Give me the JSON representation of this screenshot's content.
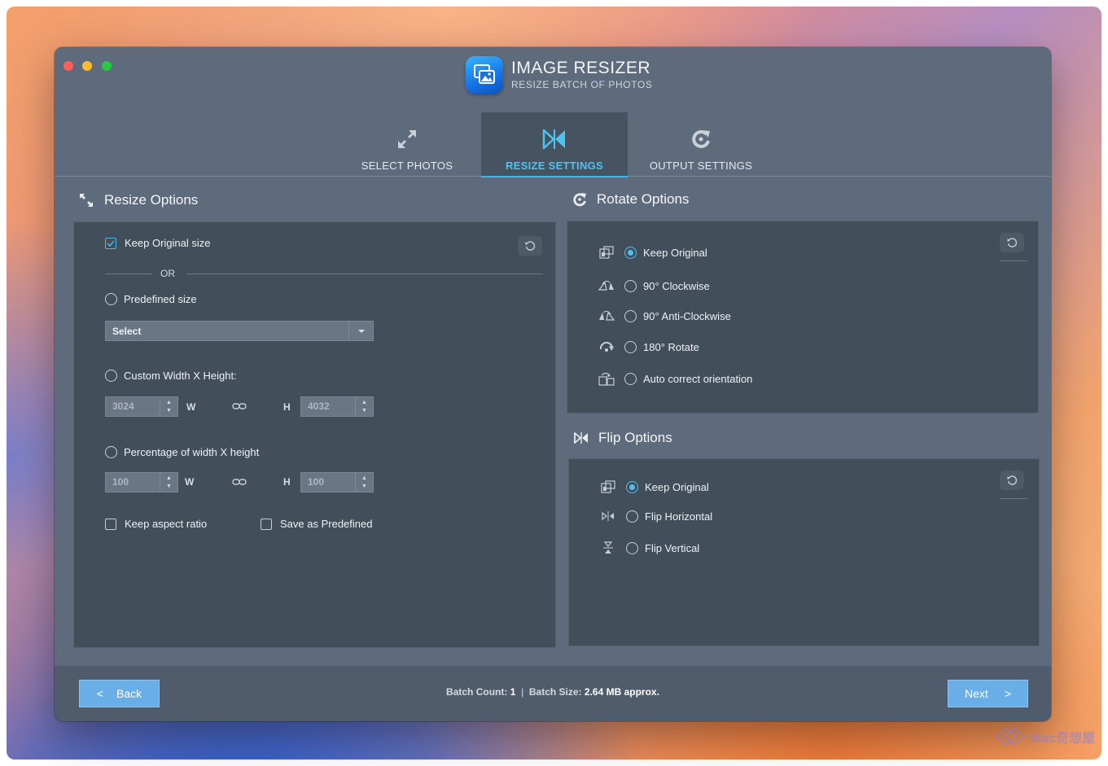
{
  "app": {
    "title": "IMAGE RESIZER",
    "subtitle": "RESIZE BATCH OF PHOTOS"
  },
  "tabs": [
    {
      "label": "SELECT PHOTOS",
      "icon": "expand-arrows-icon",
      "active": false
    },
    {
      "label": "RESIZE SETTINGS",
      "icon": "bowtie-resize-icon",
      "active": true
    },
    {
      "label": "OUTPUT SETTINGS",
      "icon": "refresh-arrow-icon",
      "active": false
    }
  ],
  "resize": {
    "title": "Resize Options",
    "keep_original_label": "Keep Original size",
    "keep_original_checked": true,
    "or_label": "OR",
    "predefined_label": "Predefined size",
    "select_value": "Select",
    "custom_label": "Custom Width X Height:",
    "custom_width": "3024",
    "custom_height": "4032",
    "w_label": "W",
    "h_label": "H",
    "percent_label": "Percentage of width X height",
    "percent_width": "100",
    "percent_height": "100",
    "keep_aspect_label": "Keep aspect ratio",
    "save_predefined_label": "Save as Predefined"
  },
  "rotate": {
    "title": "Rotate Options",
    "options": [
      {
        "label": "Keep Original",
        "icon": "keep-original-icon",
        "checked": true
      },
      {
        "label": "90° Clockwise",
        "icon": "rotate-clockwise-icon",
        "checked": false
      },
      {
        "label": "90° Anti-Clockwise",
        "icon": "rotate-anticlockwise-icon",
        "checked": false
      },
      {
        "label": "180° Rotate",
        "icon": "rotate-180-icon",
        "checked": false
      },
      {
        "label": "Auto correct orientation",
        "icon": "auto-orientation-icon",
        "checked": false
      }
    ]
  },
  "flip": {
    "title": "Flip Options",
    "options": [
      {
        "label": "Keep Original",
        "icon": "keep-original-icon",
        "checked": true
      },
      {
        "label": "Flip Horizontal",
        "icon": "flip-horizontal-icon",
        "checked": false
      },
      {
        "label": "Flip Vertical",
        "icon": "flip-vertical-icon",
        "checked": false
      }
    ]
  },
  "footer": {
    "back_label": "Back",
    "back_glyph": "<",
    "next_label": "Next",
    "next_glyph": ">",
    "batch_count_label": "Batch Count:",
    "batch_count": "1",
    "separator": "|",
    "batch_size_label": "Batch Size:",
    "batch_size": "2.64 MB approx."
  },
  "watermark": "Mac奇想屋",
  "colors": {
    "accent": "#4ec3f2",
    "button": "#6aaee8",
    "window_bg": "#5e6b7c",
    "panel_bg": "#434e5b"
  }
}
